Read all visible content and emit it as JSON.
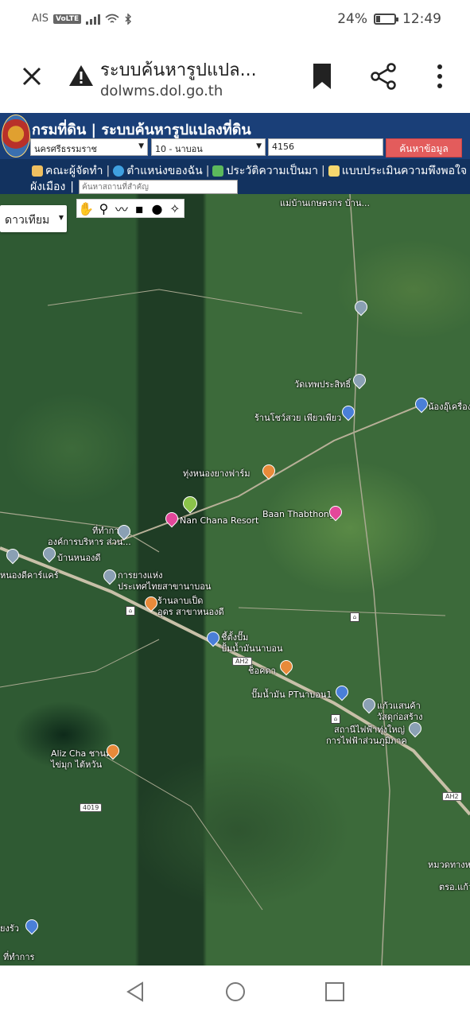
{
  "status_bar": {
    "carrier": "AIS",
    "volte": "VoLTE",
    "battery_percent": "24%",
    "time": "12:49",
    "battery_level": 0.24
  },
  "browser": {
    "title": "ระบบค้นหารูปแปล...",
    "url": "dolwms.dol.go.th"
  },
  "site": {
    "title": "กรมที่ดิน | ระบบค้นหารูปแปลงที่ดิน",
    "province_select": "นครศรีธรรมราช",
    "district_select": "10 - นาบอน",
    "parcel_number": "4156",
    "search_button": "ค้นหาข้อมูล",
    "menu": [
      {
        "label": "คณะผู้จัดทำ",
        "icon": "people-icon"
      },
      {
        "label": "ตำแหน่งของฉัน",
        "icon": "globe-icon"
      },
      {
        "label": "ประวัติความเป็นมา",
        "icon": "plant-icon"
      },
      {
        "label": "แบบประเมินความพึงพอใจ",
        "icon": "form-icon"
      }
    ],
    "menu_row2_label": "ผังเมือง",
    "place_search_placeholder": "ค้นหาสถานที่สำคัญ"
  },
  "map": {
    "map_type": "ดาวเทียม",
    "labels": {
      "l1": "แม่บ้านเกษตรกร บ้าน...",
      "l2": "วัดเทพประสิทธิ์",
      "l3": "ร้านโชว์สวย เพียวเพียว",
      "l4": "น้องอุ๊เครื่อง",
      "l5": "ทุ่งหนองยางฟาร์ม",
      "l6": "Nan Chana Resort",
      "l7": "Baan Thabthong",
      "l8": "ที่ทำการ",
      "l9": "องค์การบริหาร ส่วน...",
      "l10": "บ้านหนองดี",
      "l11": "หนองดีคาร์แคร์",
      "l12": "การยางแห่ง",
      "l13": "ประเทศไทยสาขานาบอน",
      "l14": "ร้านลาบเป็ด",
      "l15": "อุดร สาขาหนองดี",
      "l16": "ปั้มน้ำมันนาบอน",
      "l17": "ชี้ตั้งปั๊ม",
      "l18": "ช็อคดา",
      "l19": "ปั๊มน้ำมัน PTนาบอน1",
      "l20": "แก้วแสนค้า",
      "l21": "วัสดุก่อสร้าง",
      "l22": "สถานีไฟฟ้าทุ่งใหญ่",
      "l23": "การไฟฟ้าส่วนภูมิภาค",
      "l24": "Aliz Cha ชานม",
      "l25": "ไข่มุก ไต้หวัน",
      "l26": "หมวดทางห",
      "l27": "ตรอ.แก้ว",
      "l28": "ยงรัว",
      "l29": "ที่ทำการ"
    },
    "road_ah2": "AH2",
    "road_4019": "4019"
  },
  "colors": {
    "header": "#1a3f78",
    "menu": "#12325f",
    "search_button": "#e35c5c"
  }
}
